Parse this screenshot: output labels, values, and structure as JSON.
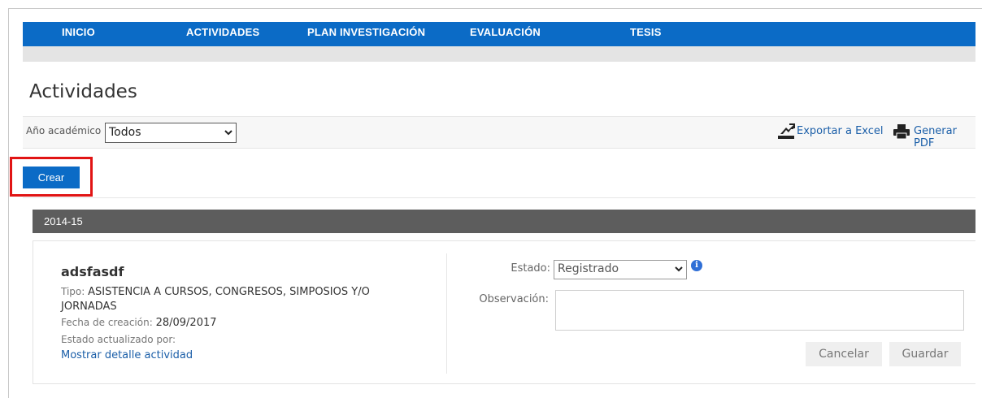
{
  "nav": {
    "items": [
      {
        "label": "INICIO"
      },
      {
        "label": "ACTIVIDADES"
      },
      {
        "label": "PLAN INVESTIGACIÓN"
      },
      {
        "label": "EVALUACIÓN"
      },
      {
        "label": "TESIS"
      }
    ],
    "accent_color": "#0b6bc6"
  },
  "page": {
    "title": "Actividades"
  },
  "filter": {
    "label": "Año académico",
    "selected": "Todos"
  },
  "exports": {
    "excel_label": "Exportar a Excel",
    "excel_icon": "export-excel-icon",
    "pdf_label": "Generar PDF",
    "pdf_icon": "printer-icon"
  },
  "actions": {
    "create_label": "Crear"
  },
  "group": {
    "year": "2014-15"
  },
  "activity": {
    "title": "adsfasdf",
    "type_label": "Tipo:",
    "type_value_line1": "ASISTENCIA A CURSOS, CONGRESOS, SIMPOSIOS Y/O",
    "type_value_line2": "JORNADAS",
    "created_label": "Fecha de creación:",
    "created_value": "28/09/2017",
    "updated_by_label": "Estado actualizado por:",
    "detail_link": "Mostrar detalle actividad"
  },
  "status_form": {
    "estado_label": "Estado:",
    "estado_selected": "Registrado",
    "observacion_label": "Observación:",
    "observacion_value": "",
    "cancel_label": "Cancelar",
    "save_label": "Guardar"
  },
  "colors": {
    "highlight": "#e11414",
    "year_header": "#5d5d5d",
    "link": "#1a5ea8"
  }
}
